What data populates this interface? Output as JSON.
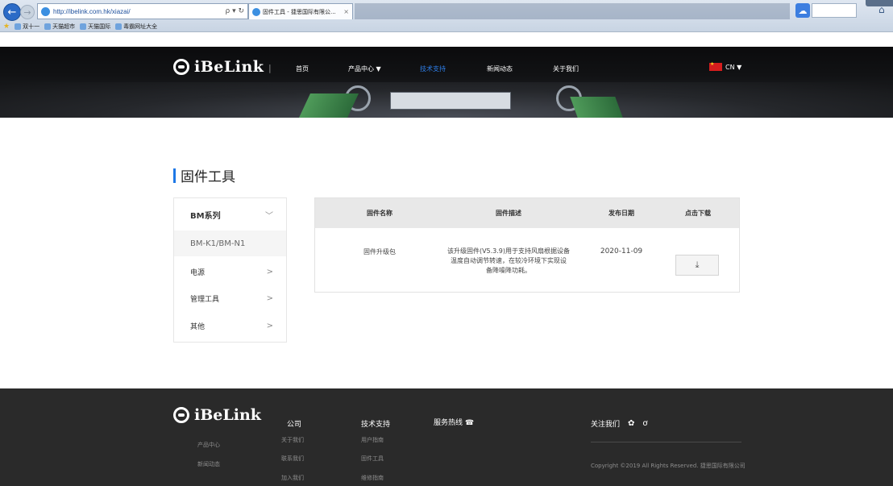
{
  "browser": {
    "url": "http://ibelink.com.hk/xiazai/",
    "search_tools": "ρ ▾ ↻",
    "tab_title": "固件工具 - 捷思国际有限公...",
    "tab_close": "×",
    "back_icon": "←",
    "forward_icon": "→",
    "ext_icon": "☁",
    "home_icon": "⌂",
    "favorites": [
      "双十一",
      "天猫超市",
      "天猫国际",
      "毒霸网址大全"
    ]
  },
  "header": {
    "brand": "iBeLink",
    "divider": "|",
    "nav": [
      {
        "label": "首页",
        "active": false
      },
      {
        "label": "产品中心 ▼",
        "active": false
      },
      {
        "label": "技术支持",
        "active": true
      },
      {
        "label": "新闻动态",
        "active": false
      },
      {
        "label": "关于我们",
        "active": false
      }
    ],
    "language": "CN ▼",
    "accent_color": "#2e7ee8"
  },
  "main": {
    "title": "固件工具",
    "menu": [
      {
        "label": "BM系列",
        "chevron": "﹀"
      },
      {
        "label": "BM-K1/BM-N1",
        "chevron": ""
      },
      {
        "label": "电源",
        "chevron": ">"
      },
      {
        "label": "管理工具",
        "chevron": ">"
      },
      {
        "label": "其他",
        "chevron": ">"
      }
    ],
    "table": {
      "headers": [
        "固件名称",
        "固件描述",
        "发布日期",
        "点击下载"
      ],
      "rows": [
        {
          "name": "固件升级包",
          "description": [
            "该升级固件(V5.3.9)用于支持风扇根据设备",
            "温度自动调节转速，在较冷环境下实现设",
            "备降噪降功耗。"
          ],
          "date": "2020-11-09",
          "download_icon": "⤓"
        }
      ]
    }
  },
  "footer": {
    "brand": "iBeLink",
    "brand_links": [
      "产品中心",
      "新闻动态"
    ],
    "columns": [
      {
        "title": "公司",
        "links": [
          "关于我们",
          "联系我们",
          "加入我们"
        ]
      },
      {
        "title": "技术支持",
        "links": [
          "用户指南",
          "固件工具",
          "维修指南"
        ]
      },
      {
        "title": "服务热线 ☎",
        "links": []
      }
    ],
    "follow": "关注我们",
    "social_icons": [
      "✿",
      "ơ"
    ],
    "copyright": "Copyright ©2019 All Rights Reserved. 捷思国际有限公司"
  }
}
